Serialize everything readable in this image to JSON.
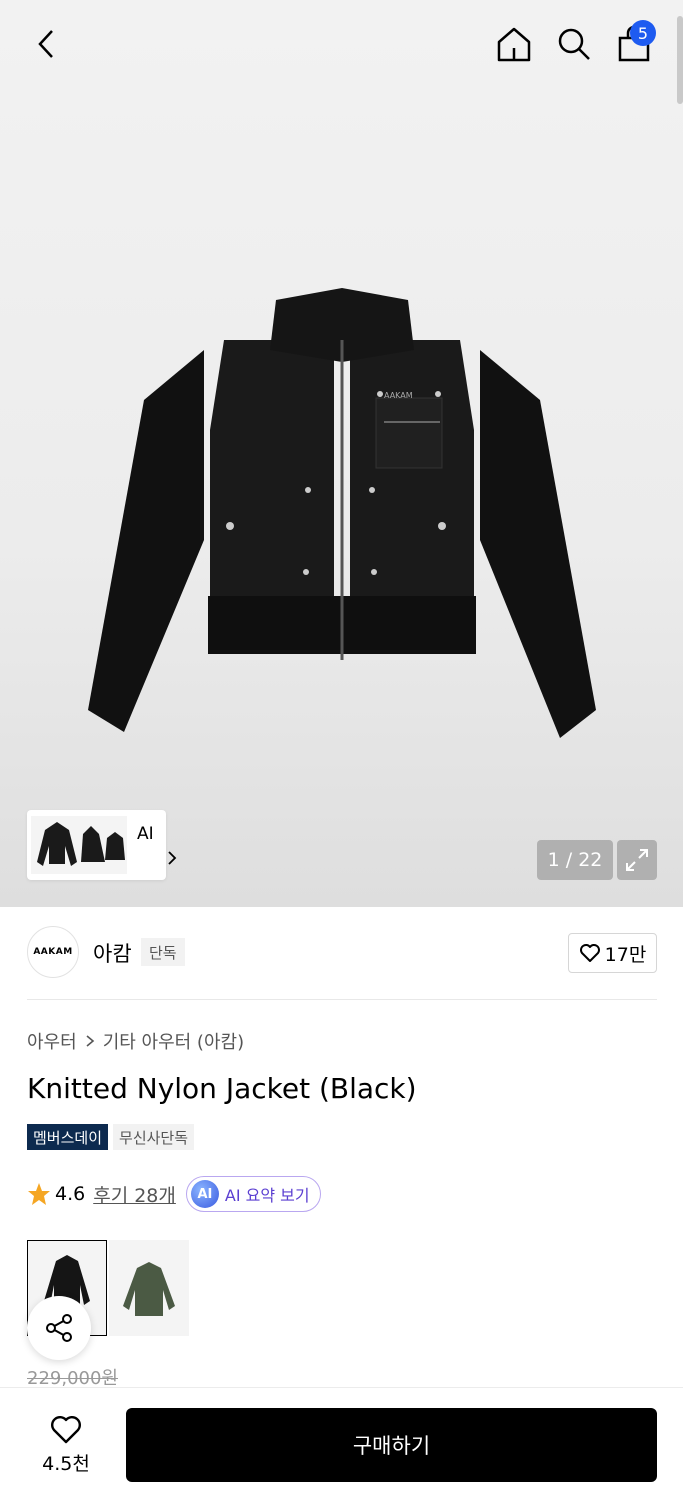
{
  "header": {
    "icons": [
      "chevron-left-icon",
      "home-icon",
      "search-icon",
      "shopping-bag-icon"
    ],
    "cart_count": "5"
  },
  "gallery": {
    "ai_label": "AI",
    "counter": "1 / 22"
  },
  "brand": {
    "logo_text": "AAKAM",
    "name": "아캄",
    "tag": "단독",
    "like_count": "17만"
  },
  "product": {
    "breadcrumb": [
      "아우터",
      "기타 아우터 (아캄)"
    ],
    "title": "Knitted Nylon Jacket (Black)",
    "badges": [
      "멤버스데이",
      "무신사단독"
    ],
    "rating": "4.6",
    "reviews_label": "후기 28개",
    "ai_summary_label": "AI 요약 보기",
    "ai_orb_text": "AI",
    "original_price": "229,000원"
  },
  "bottom_bar": {
    "wish_count": "4.5천",
    "buy_label": "구매하기"
  },
  "colors": {
    "accent_blue": "#1e5bf0",
    "badge_navy": "#0d2a4f",
    "ai_purple": "#5b3fd1"
  }
}
